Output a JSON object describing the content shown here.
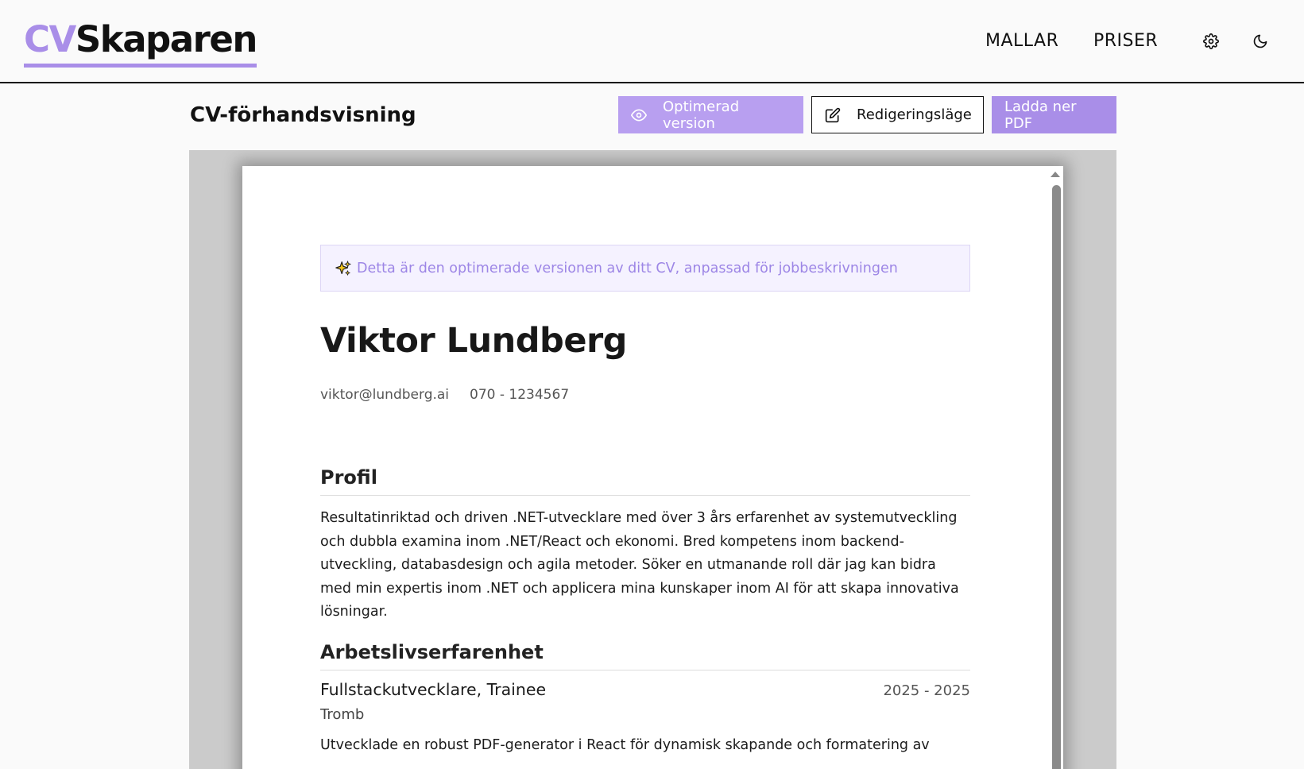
{
  "header": {
    "logo_cv": "CV",
    "logo_rest": "Skaparen",
    "nav": [
      {
        "label": "MALLAR"
      },
      {
        "label": "PRISER"
      }
    ],
    "settings_icon": "gear-icon",
    "theme_icon": "moon-icon"
  },
  "toolbar": {
    "page_title": "CV-förhandsvisning",
    "optimized_label": "Optimerad version",
    "optimized_icon": "eye-icon",
    "edit_label": "Redigeringsläge",
    "edit_icon": "edit-icon",
    "pdf_label": "Ladda ner PDF"
  },
  "cv": {
    "notice_icon": "sparkles-icon",
    "notice": "Detta är den optimerade versionen av ditt CV, anpassad för jobbeskrivningen",
    "name": "Viktor Lundberg",
    "email": "viktor@lundberg.ai",
    "phone": "070 - 1234567",
    "profile_title": "Profil",
    "profile_text": "Resultatinriktad och driven .NET-utvecklare med över 3 års erfarenhet av systemutveckling och dubbla examina inom .NET/React och ekonomi. Bred kompetens inom backend-utveckling, databasdesign och agila metoder. Söker en utmanande roll där jag kan bidra med min expertis inom .NET och applicera mina kunskaper inom AI för att skapa innovativa lösningar.",
    "work_title": "Arbetslivserfarenhet",
    "jobs": [
      {
        "title": "Fullstackutvecklare, Trainee",
        "dates": "2025 - 2025",
        "company": "Tromb",
        "description": "Utvecklade en robust PDF-generator i React för dynamisk skapande och formatering av"
      }
    ]
  },
  "colors": {
    "accent": "#a98ee8",
    "accent_light": "#b89ff0",
    "notice_bg": "#f5f2ff",
    "preview_bg": "#cbcbcb"
  }
}
